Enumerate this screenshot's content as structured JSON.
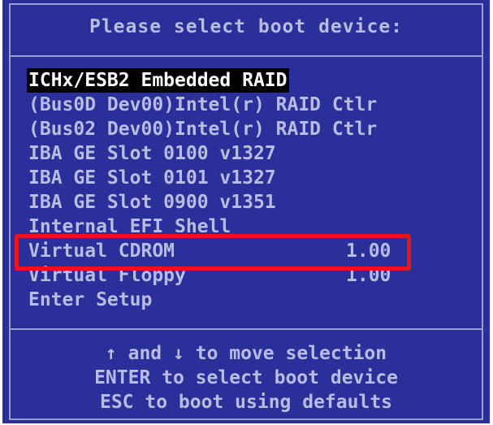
{
  "title": "Please select boot device:",
  "boot_devices": [
    {
      "label": "ICHx/ESB2 Embedded RAID",
      "version": "",
      "selected": true
    },
    {
      "label": "(Bus0D Dev00)Intel(r) RAID Ctlr",
      "version": "",
      "selected": false
    },
    {
      "label": "(Bus02 Dev00)Intel(r) RAID Ctlr",
      "version": "",
      "selected": false
    },
    {
      "label": "IBA GE Slot 0100 v1327",
      "version": "",
      "selected": false
    },
    {
      "label": "IBA GE Slot 0101 v1327",
      "version": "",
      "selected": false
    },
    {
      "label": "IBA GE Slot 0900 v1351",
      "version": "",
      "selected": false
    },
    {
      "label": "Internal EFI Shell",
      "version": "",
      "selected": false
    },
    {
      "label": "Virtual CDROM",
      "version": "1.00",
      "selected": false,
      "annotated": true
    },
    {
      "label": "Virtual Floppy",
      "version": "1.00",
      "selected": false
    },
    {
      "label": "Enter Setup",
      "version": "",
      "selected": false
    }
  ],
  "help": {
    "up_arrow": "↑",
    "down_arrow": "↓",
    "move_text": "and",
    "move_text_2": "to move selection",
    "line2": "ENTER to select boot device",
    "line3": "ESC to boot using defaults"
  },
  "annotation_color": "#e8151d",
  "background_color": "#2a2f9a"
}
